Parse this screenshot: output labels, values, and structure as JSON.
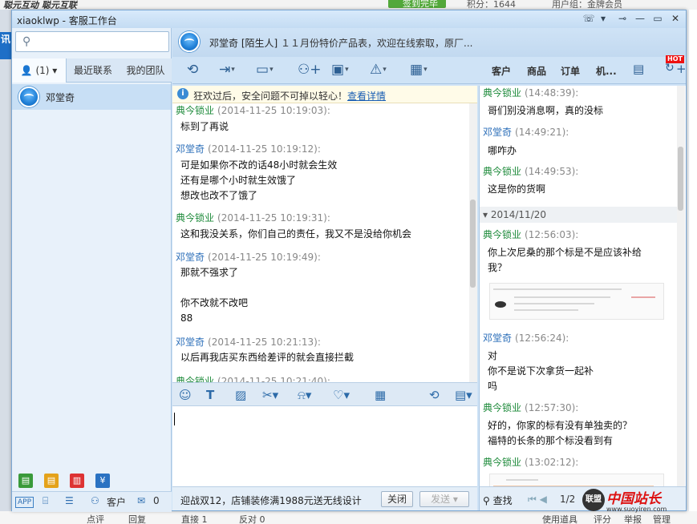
{
  "background": {
    "slogan": "聪元互动 聪元互联",
    "sign_label": "签到完毕",
    "points_label": "积分：1644",
    "group_label": "用户组：金牌会员",
    "left_tag": "讯",
    "bottom_items": [
      "点评",
      "回复",
      "直接 1",
      "反对 0",
      "使用道具",
      "评分",
      "举报",
      "管理"
    ]
  },
  "window": {
    "title": "xiaoklwp - 客服工作台"
  },
  "left_panel": {
    "search_placeholder": "",
    "tabs": [
      {
        "label": "(1)"
      },
      {
        "label": "最近联系"
      },
      {
        "label": "我的团队"
      }
    ],
    "contacts": [
      {
        "name": "邓堂奇"
      }
    ],
    "bottom": {
      "app_label": "APP",
      "customer_label": "客户",
      "message_count": "0"
    }
  },
  "chat_header": {
    "contact_name": "邓堂奇",
    "contact_tag": "[陌生人]",
    "signature": "１１月份特价产品表，欢迎在线索取，原厂..."
  },
  "toolbar_tabs": [
    "客户",
    "商品",
    "订单",
    "机..."
  ],
  "hot_badge": "HOT",
  "notice": {
    "text": "狂欢过后，安全问题不可掉以轻心！",
    "link": "查看详情"
  },
  "conversation": [
    {
      "sender": "典今锁业",
      "time": "(2014-11-25 10:19:03):",
      "text": "标到了再说",
      "me": true
    },
    {
      "sender": "邓堂奇",
      "time": "(2014-11-25 10:19:12):",
      "text": "可是如果你不改的话48小时就会生效\n还有是哪个小时就生效饿了\n想改也改不了饿了",
      "me": false
    },
    {
      "sender": "典今锁业",
      "time": "(2014-11-25 10:19:31):",
      "text": "这和我没关系，你们自己的责任，我又不是没给你机会",
      "me": true
    },
    {
      "sender": "邓堂奇",
      "time": "(2014-11-25 10:19:49):",
      "text": "那就不强求了\n\n你不改就不改吧\n88",
      "me": false
    },
    {
      "sender": "邓堂奇",
      "time": "(2014-11-25 10:21:13):",
      "text": "以后再我店买东西给差评的就会直接拦截",
      "me": false
    },
    {
      "sender": "典今锁业",
      "time": "(2014-11-25 10:21:40):",
      "text": "",
      "me": true
    }
  ],
  "send_bar": {
    "ad_text": "迎战双12，店铺装修满1988元送无线设计",
    "close_label": "关闭",
    "send_label": "发送"
  },
  "history": {
    "messages": [
      {
        "sender": "典今锁业",
        "time": "(14:48:39):",
        "text": "哥们别没消息啊，真的没标",
        "me": true
      },
      {
        "sender": "邓堂奇",
        "time": "(14:49:21):",
        "text": "哪咋办",
        "me": false
      },
      {
        "sender": "典今锁业",
        "time": "(14:49:53):",
        "text": "这是你的货啊",
        "me": true
      }
    ],
    "date_separator": "2014/11/20",
    "messages2": [
      {
        "sender": "典今锁业",
        "time": "(12:56:03):",
        "text": "你上次尼桑的那个标是不是应该补给\n我？",
        "me": true
      },
      {
        "sender": "邓堂奇",
        "time": "(12:56:24):",
        "text": "对\n你不是说下次拿货一起补\n吗",
        "me": false
      },
      {
        "sender": "典今锁业",
        "time": "(12:57:30):",
        "text": "好的，你家的标有没有单独卖的？\n福特的长条的那个标没看到有",
        "me": true
      },
      {
        "sender": "典今锁业",
        "time": "(13:02:12):",
        "text": "",
        "me": true
      }
    ],
    "search_label": "查找",
    "page": "1/2"
  },
  "watermark": {
    "badge": "联盟",
    "big": "中国站长",
    "url": "www.suoyiren.com"
  }
}
